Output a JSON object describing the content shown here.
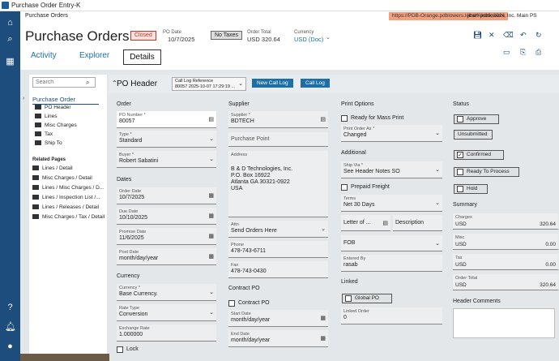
{
  "window": {
    "title": "Purchase Order Entry-K"
  },
  "topbar": {
    "breadcrumb": "Purchase Orders",
    "url": "https://PDB-Orange.pdblowers.local/Kinetic2024",
    "user": "jlhen   pdblowers, Inc.   Main PS"
  },
  "header": {
    "title": "Purchase Orders",
    "status_badge": "Closed",
    "po_date_label": "PO Date",
    "po_date": "10/7/2025",
    "tax_badge": "No Taxes",
    "order_total_label": "Order Total",
    "order_total": "USD  320.64",
    "currency_label": "Currency",
    "currency": "USD (Doc)"
  },
  "tabs": [
    "Activity",
    "Explorer",
    "Details"
  ],
  "sidebar": {
    "search_placeholder": "Search",
    "section": "Purchase Order",
    "items": [
      "PO Header",
      "Lines",
      "Misc Charges",
      "Tax",
      "Ship To"
    ],
    "related_label": "Related Pages",
    "related": [
      "Lines / Detail",
      "Misc Charges / Detail",
      "Lines / Misc Charges / D...",
      "Lines / Inspection List /...",
      "Lines / Releases / Detail",
      "Misc Charges / Tax / Detail"
    ]
  },
  "po_header": {
    "title": "PO Header",
    "change_log_label": "Call Log Reference",
    "change_log_value": "80057 2025-10-07 17:29:19 ...",
    "new_call_log": "New Call Log",
    "call_log": "Call Log"
  },
  "order": {
    "label": "Order",
    "po_number_label": "PO Number *",
    "po_number": "80057",
    "type_label": "Type *",
    "type": "Standard",
    "buyer_label": "Buyer *",
    "buyer": "Robert Sabatini"
  },
  "dates": {
    "label": "Dates",
    "order_date_label": "Order Date",
    "order_date": "10/7/2025",
    "due_date_label": "Due Date",
    "due_date": "10/10/2025",
    "promise_date_label": "Promise Date",
    "promise_date": "11/6/2025",
    "post_date_label": "Post Date",
    "post_date": "month/day/year"
  },
  "currency": {
    "label": "Currency",
    "currency_label": "Currency *",
    "currency": "Base Currency.",
    "rate_type_label": "Rate Type",
    "rate_type": "Conversion",
    "exchange_rate_label": "Exchange Rate",
    "exchange_rate": "1.000000",
    "lock_label": "Lock"
  },
  "supplier": {
    "label": "Supplier",
    "supplier_label": "Supplier *",
    "supplier": "BDTECH",
    "purchase_point_placeholder": "Purchase Point",
    "address_label": "Address",
    "address_lines": [
      "B & D Technologies, Inc.",
      "P.O. Box 16922",
      "Atlanta GA 30321-0922",
      "USA"
    ],
    "attn_label": "Attn",
    "attn": "Send Orders Here",
    "phone_label": "Phone",
    "phone": "478-743-6711",
    "fax_label": "Fax",
    "fax": "478-743-0430"
  },
  "contract_po": {
    "label": "Contract PO",
    "checkbox_label": "Contract PO",
    "start_date_label": "Start Date",
    "start_date": "month/day/year",
    "end_date_label": "End Date",
    "end_date": "month/day/year"
  },
  "print_options": {
    "label": "Print Options",
    "ready_label": "Ready for Mass Print",
    "print_order_as_label": "Print Order As *",
    "print_order_as": "Changed"
  },
  "additional": {
    "label": "Additional",
    "ship_via_label": "Ship Via *",
    "ship_via": "See Header Notes SO",
    "prepaid_label": "Prepaid Freight",
    "terms_label": "Terms",
    "terms": "Net 30 Days",
    "letter_placeholder": "Letter of ...",
    "description_placeholder": "Description",
    "fob_placeholder": "FOB",
    "entered_by_label": "Entered By",
    "entered_by": "rasab"
  },
  "linked": {
    "label": "Linked",
    "global_po_label": "Global PO",
    "linked_order_label": "Linked Order",
    "linked_order": "0"
  },
  "status": {
    "label": "Status",
    "approve": "Approve",
    "unsubmitted": "Unsubmitted",
    "confirmed": "Confirmed",
    "ready_to_process": "Ready To Process",
    "hold": "Hold"
  },
  "summary": {
    "label": "Summary",
    "rows": [
      {
        "label": "Charges",
        "currency": "USD",
        "amount": "320.64"
      },
      {
        "label": "Misc",
        "currency": "USD",
        "amount": "0.00"
      },
      {
        "label": "Tax",
        "currency": "USD",
        "amount": "0.00"
      },
      {
        "label": "Order Total",
        "currency": "USD",
        "amount": "320.64"
      }
    ]
  },
  "header_comments": {
    "label": "Header Comments"
  },
  "colors": {
    "brand": "#1d4d7c",
    "button": "#1d6fa5",
    "closed": "#c0392b",
    "url_bg": "#f3a07d"
  }
}
